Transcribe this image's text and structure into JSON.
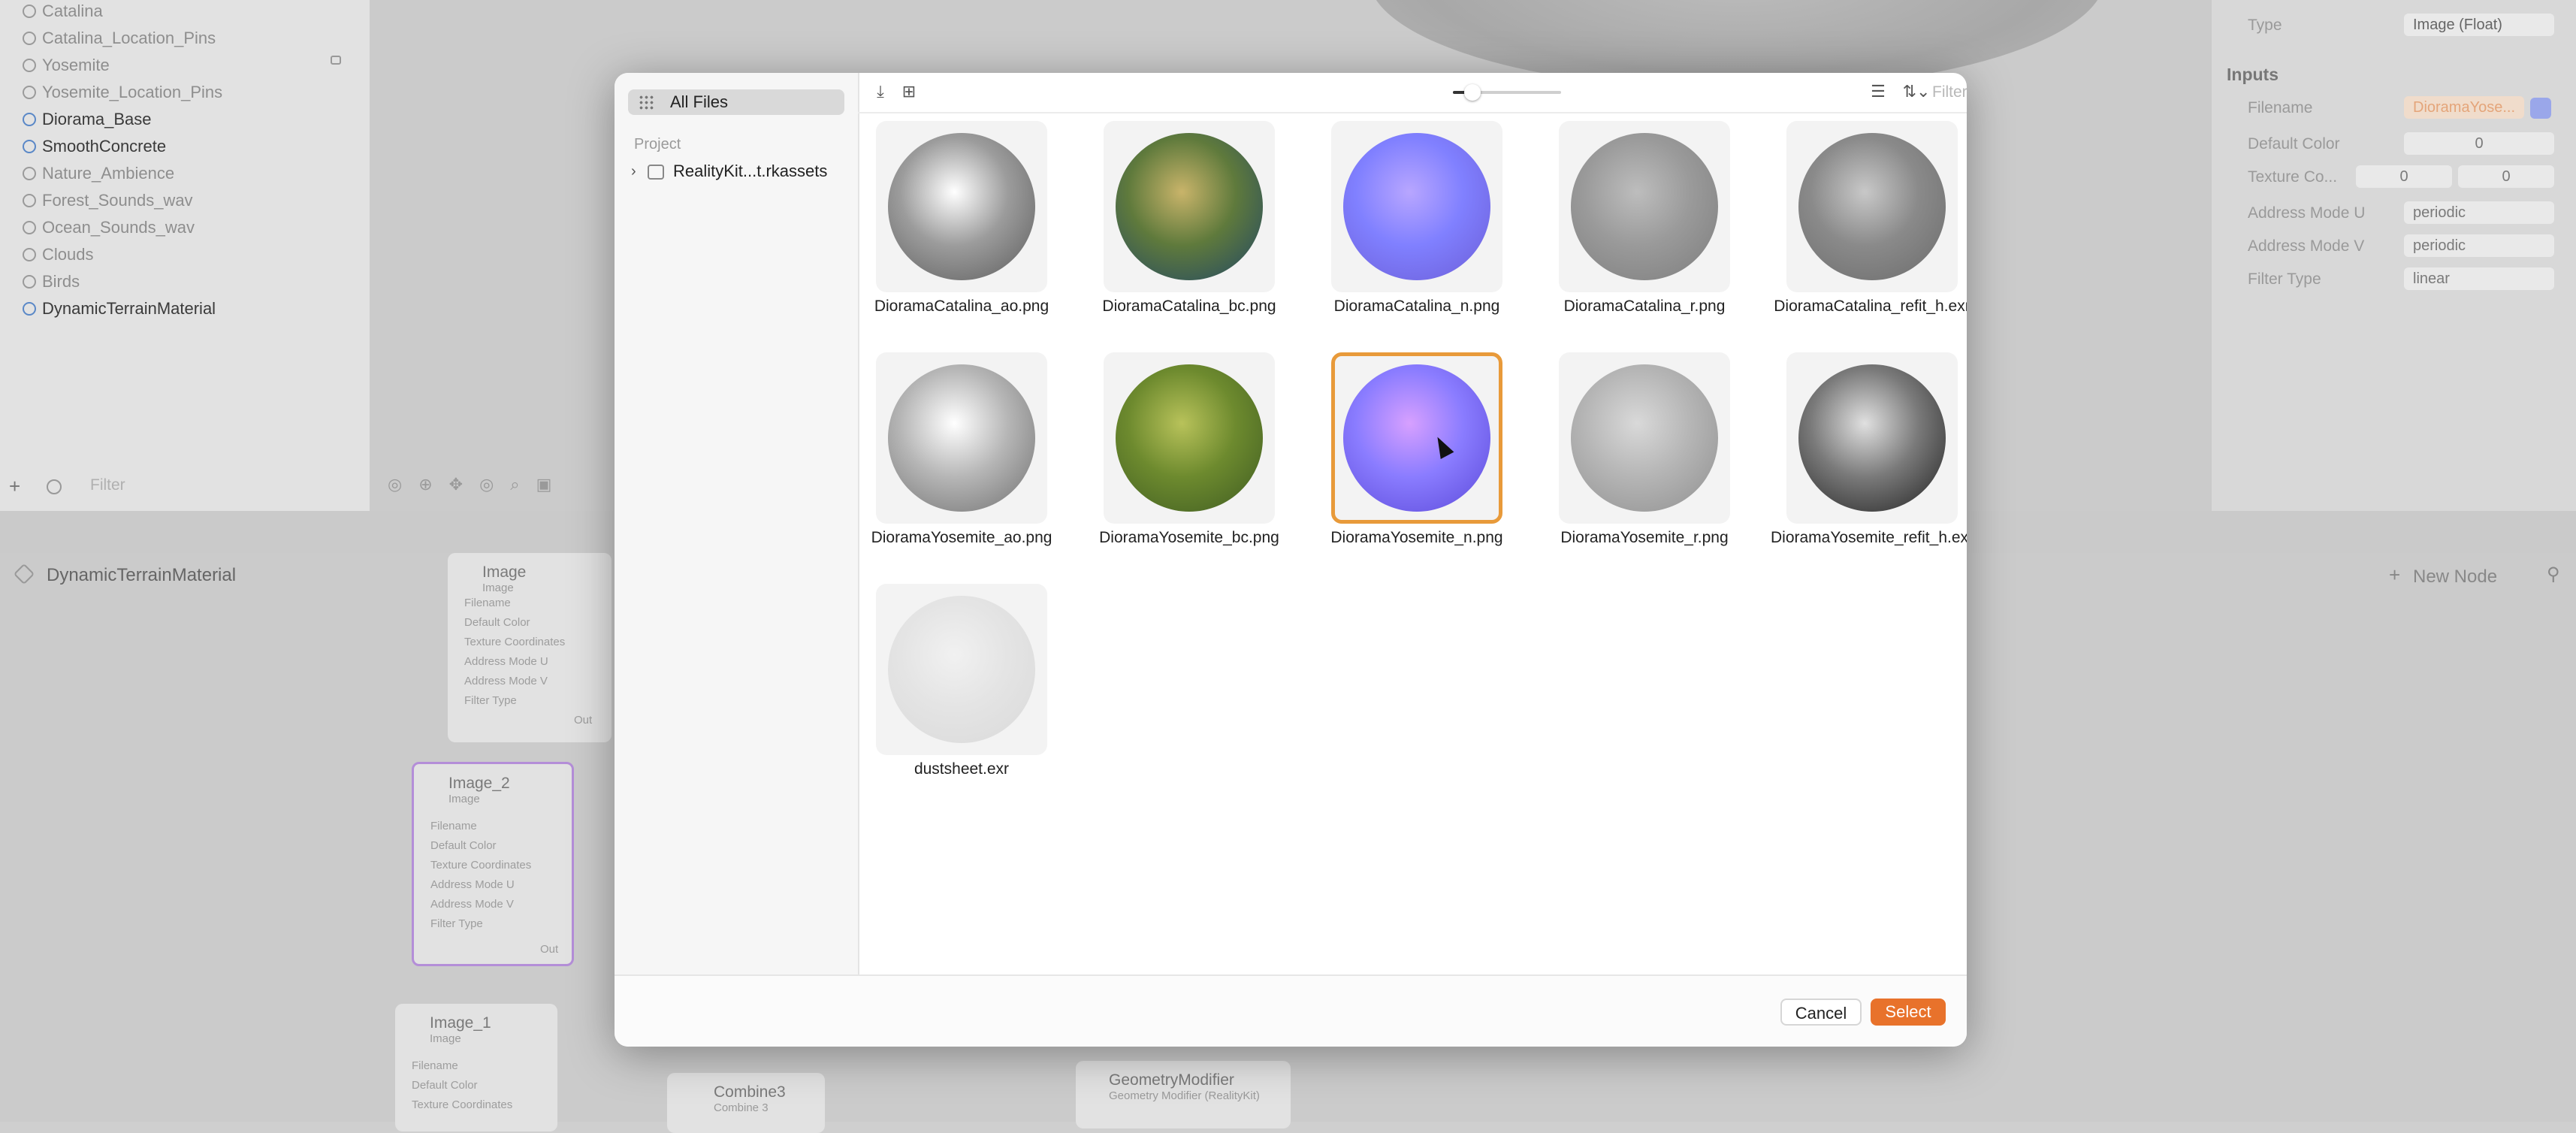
{
  "outline": {
    "items": [
      {
        "label": "Catalina",
        "dark": false
      },
      {
        "label": "Catalina_Location_Pins",
        "dark": false
      },
      {
        "label": "Yosemite",
        "dark": false
      },
      {
        "label": "Yosemite_Location_Pins",
        "dark": false
      },
      {
        "label": "Diorama_Base",
        "dark": true
      },
      {
        "label": "SmoothConcrete",
        "dark": true
      },
      {
        "label": "Nature_Ambience",
        "dark": false
      },
      {
        "label": "Forest_Sounds_wav",
        "dark": false
      },
      {
        "label": "Ocean_Sounds_wav",
        "dark": false
      },
      {
        "label": "Clouds",
        "dark": false
      },
      {
        "label": "Birds",
        "dark": false
      },
      {
        "label": "DynamicTerrainMaterial",
        "dark": true
      }
    ],
    "filter_placeholder": "Filter"
  },
  "inspector": {
    "type_label": "Type",
    "type_value": "Image (Float)",
    "inputs_header": "Inputs",
    "filename_label": "Filename",
    "filename_value": "DioramaYose...",
    "default_color_label": "Default Color",
    "default_color_value": "0",
    "texture_coord_label": "Texture Co...",
    "texture_coord_u": "0",
    "texture_coord_v": "0",
    "address_u_label": "Address Mode U",
    "address_u_value": "periodic",
    "address_v_label": "Address Mode V",
    "address_v_value": "periodic",
    "filter_type_label": "Filter Type",
    "filter_type_value": "linear"
  },
  "graph": {
    "breadcrumb": "DynamicTerrainMaterial",
    "new_node_label": "New Node",
    "nodes": {
      "image": {
        "title": "Image",
        "subtitle": "Image",
        "rows": [
          "Filename",
          "Default Color",
          "Texture Coordinates",
          "Address Mode U",
          "Address Mode V",
          "Filter Type"
        ],
        "out": "Out"
      },
      "image2": {
        "title": "Image_2",
        "subtitle": "Image",
        "rows": [
          "Filename",
          "Default Color",
          "Texture Coordinates",
          "Address Mode U",
          "Address Mode V",
          "Filter Type"
        ],
        "out": "Out"
      },
      "image1": {
        "title": "Image_1",
        "subtitle": "Image",
        "rows": [
          "Filename",
          "Default Color",
          "Texture Coordinates"
        ]
      },
      "combine3": {
        "title": "Combine3",
        "subtitle": "Combine 3"
      },
      "geometry": {
        "title": "GeometryModifier",
        "subtitle": "Geometry Modifier (RealityKit)"
      }
    }
  },
  "dialog": {
    "sidebar": {
      "all_files": "All Files",
      "project_header": "Project",
      "project_item": "RealityKit...t.rkassets"
    },
    "toolbar": {
      "filter_placeholder": "Filter",
      "zoom_level": 0.18
    },
    "files": [
      {
        "name": "DioramaCatalina_ao.png",
        "colors": [
          "#ffffff",
          "#9c9c9c",
          "#5a5a5a"
        ]
      },
      {
        "name": "DioramaCatalina_bc.png",
        "colors": [
          "#c9b46a",
          "#5f7a3c",
          "#1f4566"
        ]
      },
      {
        "name": "DioramaCatalina_n.png",
        "colors": [
          "#b8a6ff",
          "#8080ff",
          "#6b5cd6"
        ]
      },
      {
        "name": "DioramaCatalina_r.png",
        "colors": [
          "#bdbdbd",
          "#9a9a9a",
          "#7c7c7c"
        ]
      },
      {
        "name": "DioramaCatalina_refit_h.exr",
        "colors": [
          "#c8c8c8",
          "#8a8a8a",
          "#6a6a6a"
        ]
      },
      {
        "name": "DioramaYosemite_ao.png",
        "colors": [
          "#ffffff",
          "#b6b6b6",
          "#6e6e6e"
        ]
      },
      {
        "name": "DioramaYosemite_bc.png",
        "colors": [
          "#b8c25a",
          "#6d8a2e",
          "#3d5a22"
        ]
      },
      {
        "name": "DioramaYosemite_n.png",
        "colors": [
          "#d7a0ff",
          "#8a7cff",
          "#5a48d8"
        ]
      },
      {
        "name": "DioramaYosemite_r.png",
        "colors": [
          "#d9d9d9",
          "#b5b5b5",
          "#8e8e8e"
        ]
      },
      {
        "name": "DioramaYosemite_refit_h.exr",
        "colors": [
          "#e0e0e0",
          "#7a7a7a",
          "#1e1e1e"
        ]
      },
      {
        "name": "dustsheet.exr",
        "colors": [
          "#f1f1f1",
          "#e4e4e4",
          "#d9d9d9"
        ]
      }
    ],
    "selected_index": 7,
    "cancel_label": "Cancel",
    "select_label": "Select"
  },
  "colors": {
    "accent": "#e8722b",
    "selection_border": "#e89a3a"
  }
}
